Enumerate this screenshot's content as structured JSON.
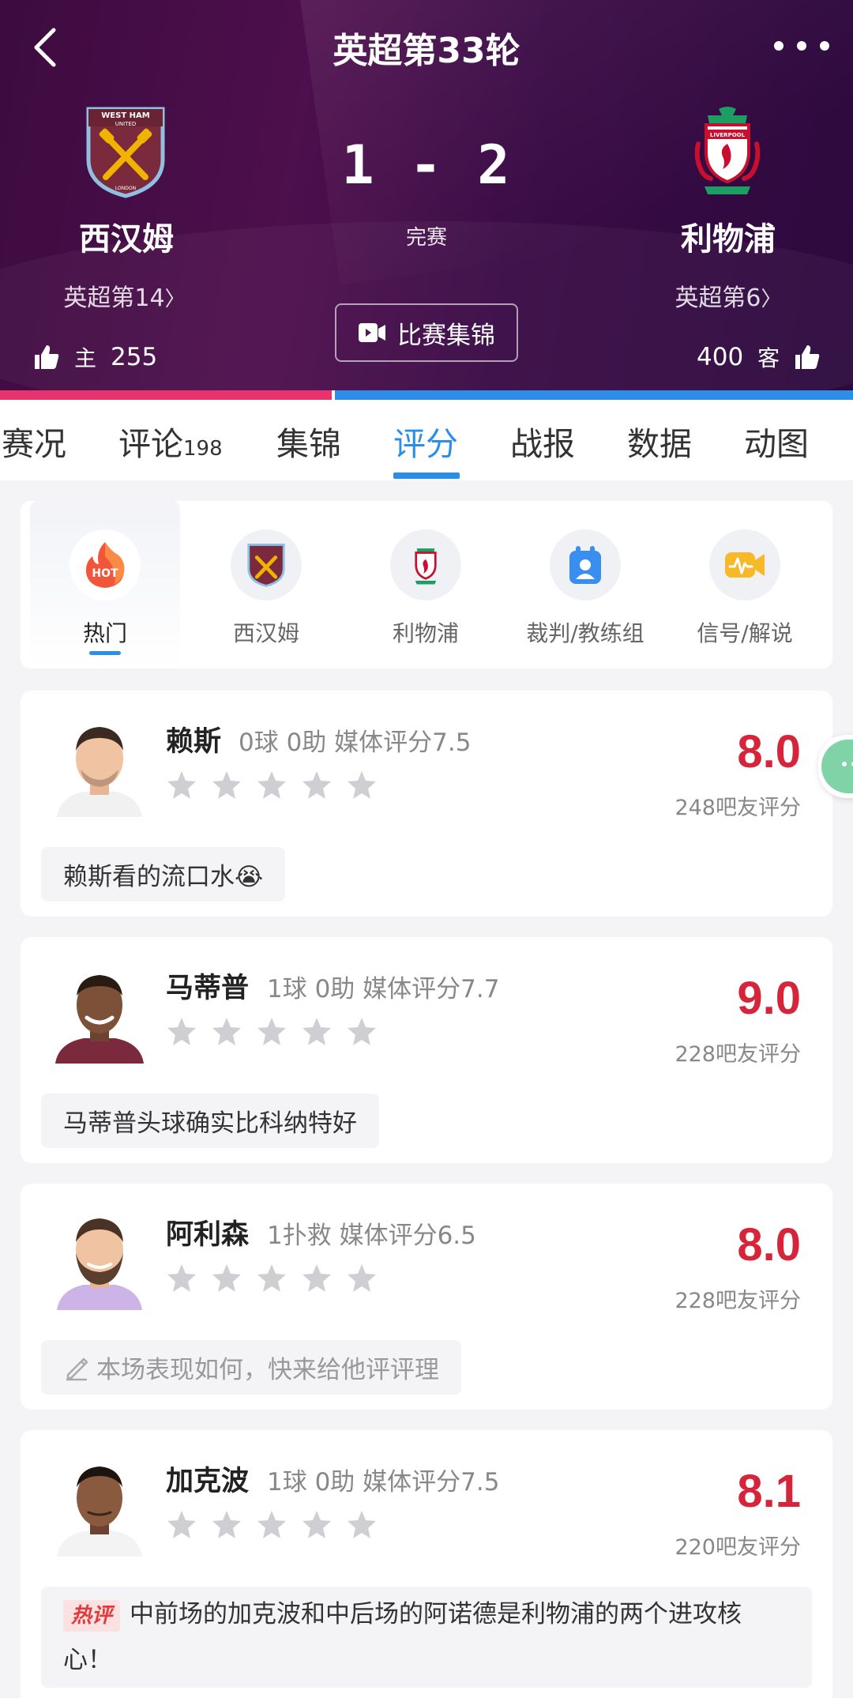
{
  "header": {
    "title": "英超第33轮",
    "score": "1 - 2",
    "status": "完赛",
    "highlight_label": "比赛集锦",
    "home": {
      "name": "西汉姆",
      "rank": "英超第14",
      "like_label": "主",
      "like_count": "255",
      "crest_text": "WEST HAM UNITED",
      "crest_sub": "LONDON"
    },
    "away": {
      "name": "利物浦",
      "rank": "英超第6",
      "like_label": "客",
      "like_count": "400",
      "crest_text": "LIVERPOOL"
    },
    "colors": {
      "home_bar": "#e8336f",
      "away_bar": "#2e8ee6"
    }
  },
  "tabs": [
    {
      "label": "赛况"
    },
    {
      "label": "评论",
      "count": "198"
    },
    {
      "label": "集锦"
    },
    {
      "label": "评分",
      "active": true
    },
    {
      "label": "战报"
    },
    {
      "label": "数据"
    },
    {
      "label": "动图"
    }
  ],
  "filters": [
    {
      "label": "热门",
      "icon": "hot-icon",
      "active": true,
      "icon_text": "HOT"
    },
    {
      "label": "西汉姆",
      "icon": "west-ham-crest-icon"
    },
    {
      "label": "利物浦",
      "icon": "liverpool-crest-icon"
    },
    {
      "label": "裁判/教练组",
      "icon": "referee-icon"
    },
    {
      "label": "信号/解说",
      "icon": "signal-icon"
    }
  ],
  "players": [
    {
      "name": "赖斯",
      "stats": "0球 0助  媒体评分7.5",
      "rating": "8.0",
      "count": "248吧友评分",
      "comment": "赖斯看的流口水😭",
      "comment_type": "normal"
    },
    {
      "name": "马蒂普",
      "stats": "1球 0助  媒体评分7.7",
      "rating": "9.0",
      "count": "228吧友评分",
      "comment": "马蒂普头球确实比科纳特好",
      "comment_type": "normal"
    },
    {
      "name": "阿利森",
      "stats": "1扑救  媒体评分6.5",
      "rating": "8.0",
      "count": "228吧友评分",
      "comment": "本场表现如何，快来给他评评理",
      "comment_type": "placeholder"
    },
    {
      "name": "加克波",
      "stats": "1球 0助  媒体评分7.5",
      "rating": "8.1",
      "count": "220吧友评分",
      "comment": "中前场的加克波和中后场的阿诺德是利物浦的两个进攻核心！",
      "comment_type": "hot",
      "hot_label": "热评"
    }
  ]
}
